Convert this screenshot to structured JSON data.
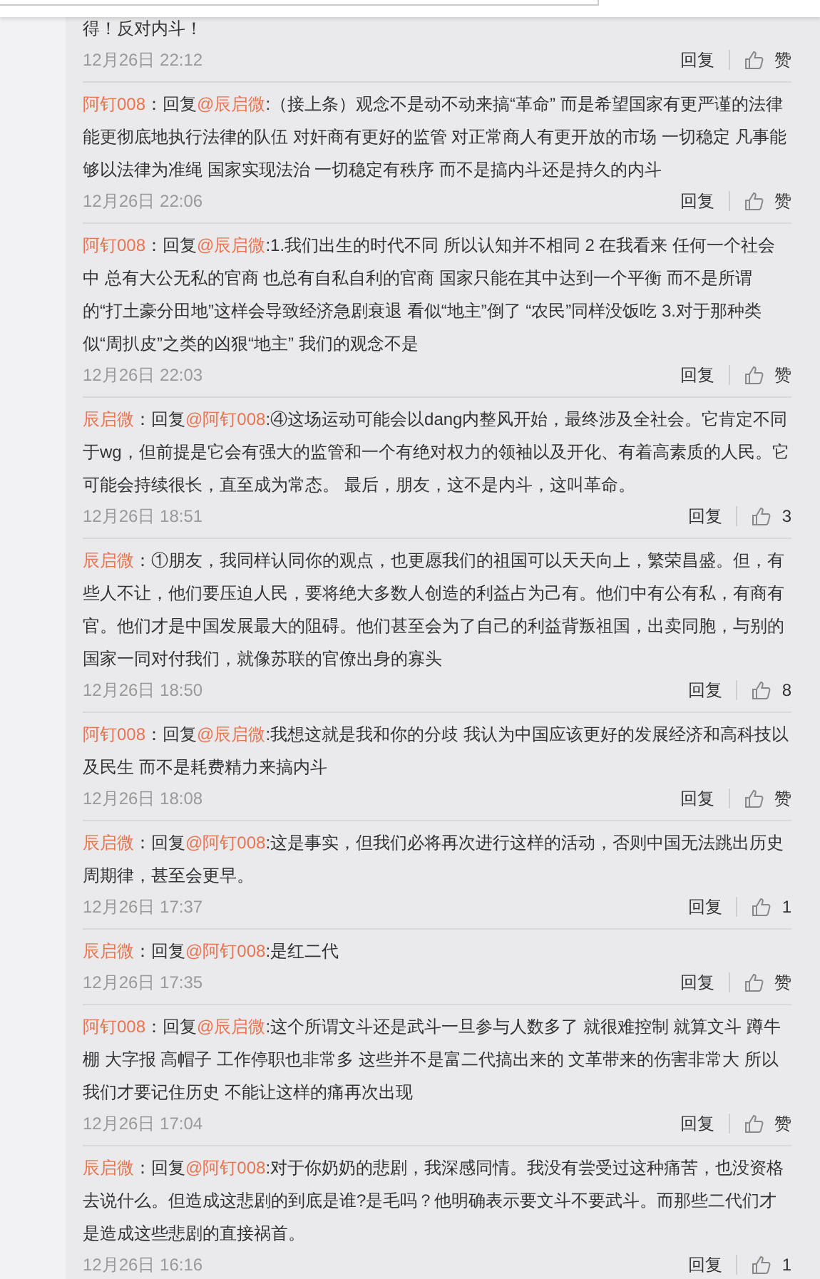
{
  "comments": [
    {
      "text": "得！反对内斗！",
      "time": "12月26日 22:12",
      "reply_label": "回复",
      "like_label": "赞"
    },
    {
      "author": "阿钉008",
      "prefix": "：回复",
      "mention": "@辰启微",
      "text": ":（接上条）观念不是动不动来搞“革命” 而是希望国家有更严谨的法律能更彻底地执行法律的队伍 对奸商有更好的监管 对正常商人有更开放的市场 一切稳定 凡事能够以法律为准绳 国家实现法治 一切稳定有秩序 而不是搞内斗还是持久的内斗",
      "time": "12月26日 22:06",
      "reply_label": "回复",
      "like_label": "赞"
    },
    {
      "author": "阿钉008",
      "prefix": "：回复",
      "mention": "@辰启微",
      "text": ":1.我们出生的时代不同 所以认知并不相同 2 在我看来 任何一个社会中 总有大公无私的官商 也总有自私自利的官商 国家只能在其中达到一个平衡 而不是所谓的“打土豪分田地”这样会导致经济急剧衰退 看似“地主”倒了 “农民”同样没饭吃 3.对于那种类似“周扒皮”之类的凶狠“地主” 我们的观念不是",
      "time": "12月26日 22:03",
      "reply_label": "回复",
      "like_label": "赞"
    },
    {
      "author": "辰启微",
      "prefix": "：回复",
      "mention": "@阿钉008",
      "text": ":④这场运动可能会以dang内整风开始，最终涉及全社会。它肯定不同于wg，但前提是它会有强大的监管和一个有绝对权力的领袖以及开化、有着高素质的人民。它可能会持续很长，直至成为常态。 最后，朋友，这不是内斗，这叫革命。",
      "time": "12月26日 18:51",
      "reply_label": "回复",
      "like_label": "3"
    },
    {
      "author": "辰启微",
      "prefix": "：",
      "text": "①朋友，我同样认同你的观点，也更愿我们的祖国可以天天向上，繁荣昌盛。但，有些人不让，他们要压迫人民，要将绝大多数人创造的利益占为己有。他们中有公有私，有商有官。他们才是中国发展最大的阻碍。他们甚至会为了自己的利益背叛祖国，出卖同胞，与别的国家一同对付我们，就像苏联的官僚出身的寡头",
      "time": "12月26日 18:50",
      "reply_label": "回复",
      "like_label": "8"
    },
    {
      "author": "阿钉008",
      "prefix": "：回复",
      "mention": "@辰启微",
      "text": ":我想这就是我和你的分歧 我认为中国应该更好的发展经济和高科技以及民生 而不是耗费精力来搞内斗",
      "time": "12月26日 18:08",
      "reply_label": "回复",
      "like_label": "赞"
    },
    {
      "author": "辰启微",
      "prefix": "：回复",
      "mention": "@阿钉008",
      "text": ":这是事实，但我们必将再次进行这样的活动，否则中国无法跳出历史周期律，甚至会更早。",
      "time": "12月26日 17:37",
      "reply_label": "回复",
      "like_label": "1"
    },
    {
      "author": "辰启微",
      "prefix": "：回复",
      "mention": "@阿钉008",
      "text": ":是红二代",
      "time": "12月26日 17:35",
      "reply_label": "回复",
      "like_label": "赞"
    },
    {
      "author": "阿钉008",
      "prefix": "：回复",
      "mention": "@辰启微",
      "text": ":这个所谓文斗还是武斗一旦参与人数多了 就很难控制 就算文斗 蹲牛棚 大字报 高帽子 工作停职也非常多 这些并不是富二代搞出来的 文革带来的伤害非常大 所以我们才要记住历史 不能让这样的痛再次出现",
      "time": "12月26日 17:04",
      "reply_label": "回复",
      "like_label": "赞"
    },
    {
      "author": "辰启微",
      "prefix": "：回复",
      "mention": "@阿钉008",
      "text": ":对于你奶奶的悲剧，我深感同情。我没有尝受过这种痛苦，也没资格去说什么。但造成这悲剧的到底是谁?是毛吗？他明确表示要文斗不要武斗。而那些二代们才是造成这些悲剧的直接祸首。",
      "time": "12月26日 16:16",
      "reply_label": "回复",
      "like_label": "1"
    }
  ]
}
